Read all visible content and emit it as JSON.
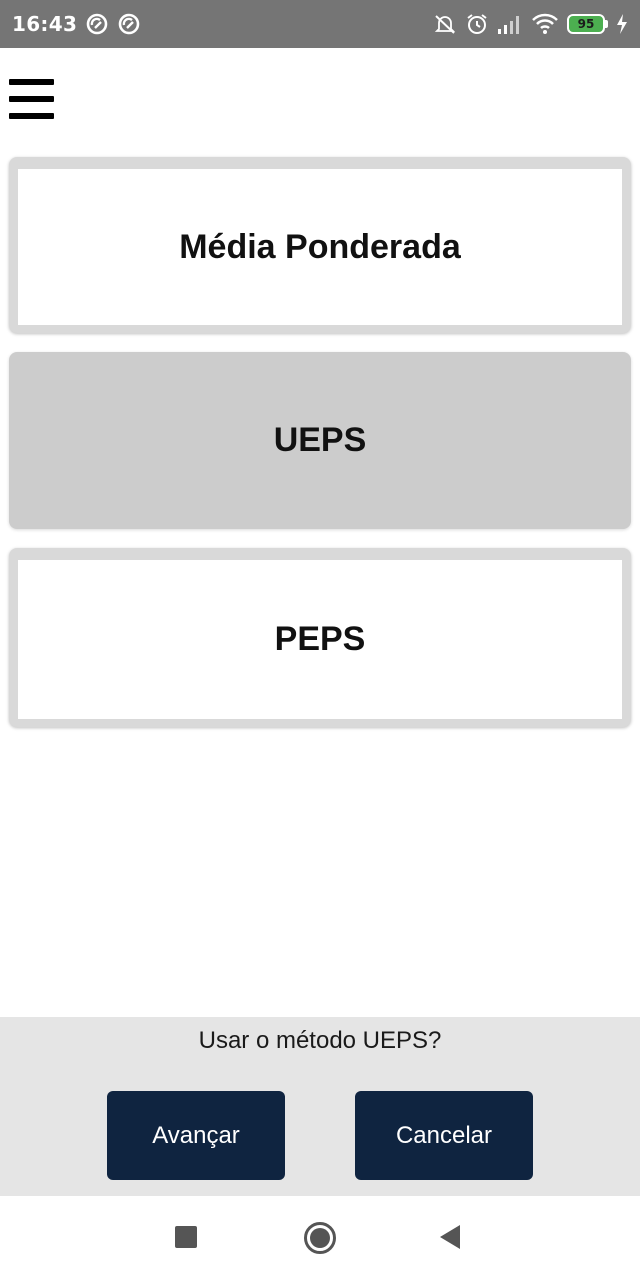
{
  "status_bar": {
    "time": "16:43",
    "battery_level": "95",
    "icons": [
      "notification-icon",
      "notification-icon",
      "mute-icon",
      "alarm-icon",
      "signal-icon",
      "wifi-icon",
      "battery-icon",
      "charging-icon"
    ]
  },
  "menu": {
    "icon": "hamburger-menu-icon"
  },
  "methods": [
    {
      "label": "Média Ponderada",
      "selected": false
    },
    {
      "label": "UEPS",
      "selected": true
    },
    {
      "label": "PEPS",
      "selected": false
    }
  ],
  "confirm": {
    "question": "Usar o método UEPS?",
    "advance_label": "Avançar",
    "cancel_label": "Cancelar",
    "button_color": "#0f2440"
  },
  "nav_bar": {
    "icons": [
      "recent-apps-icon",
      "home-icon",
      "back-icon"
    ]
  }
}
